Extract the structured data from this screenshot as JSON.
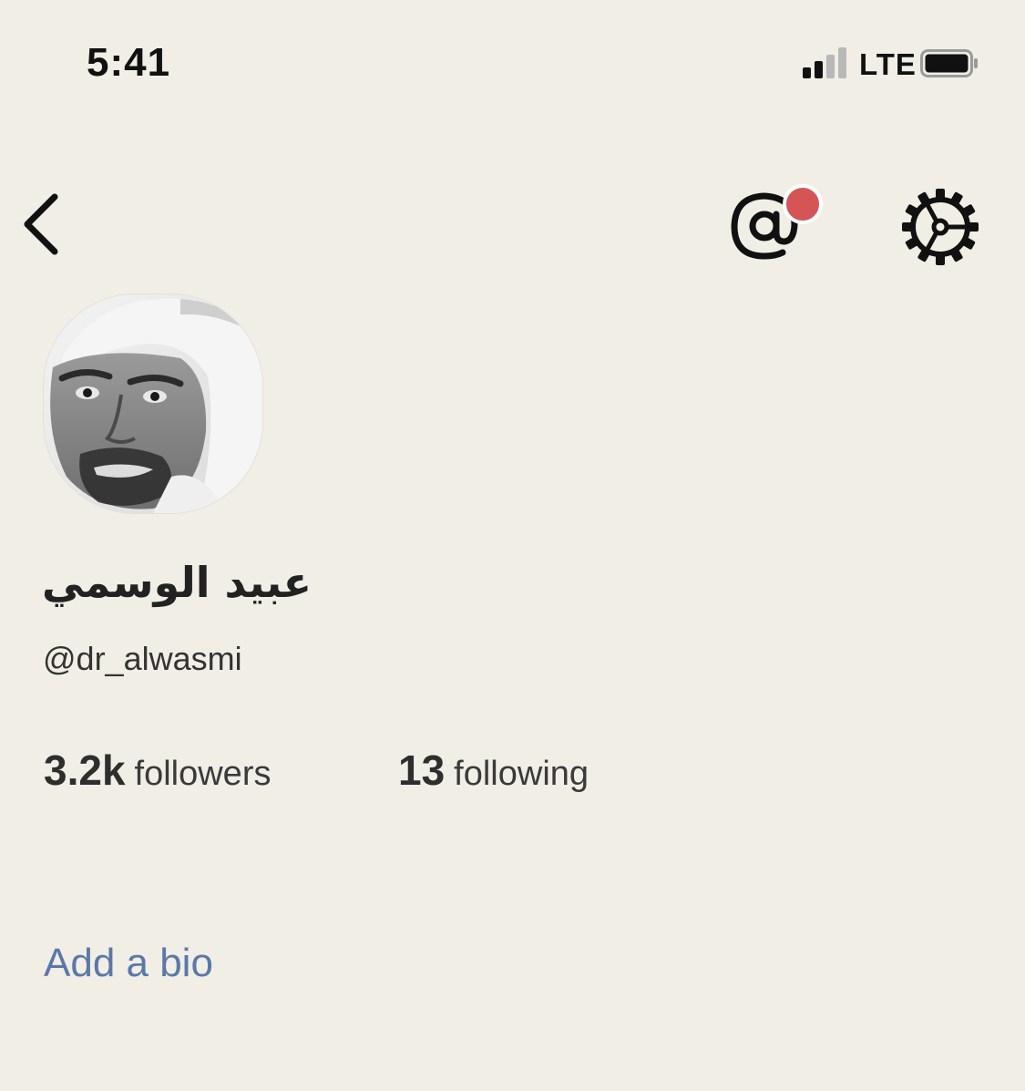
{
  "status_bar": {
    "time": "5:41",
    "network": "LTE",
    "signal_bars_active": 2,
    "signal_bars_total": 4,
    "battery_level": 1.0
  },
  "nav": {
    "back_icon": "chevron-left-icon",
    "mention_icon": "at-sign-icon",
    "mention_has_notification": true,
    "notification_color": "#d55456",
    "settings_icon": "gear-icon"
  },
  "profile": {
    "display_name": "عبيد الوسمي",
    "username": "@dr_alwasmi",
    "followers_count": "3.2k",
    "followers_label": "followers",
    "following_count": "13",
    "following_label": "following",
    "add_bio_label": "Add a bio"
  },
  "colors": {
    "background": "#f1eee6",
    "link": "#5b78a8",
    "notification_dot": "#d55456"
  }
}
